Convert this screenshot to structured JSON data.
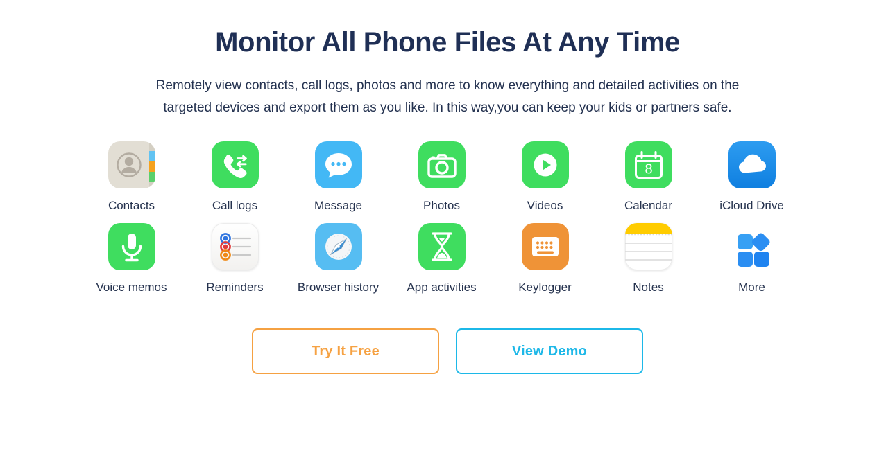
{
  "header": {
    "title": "Monitor All Phone Files At Any Time",
    "subtitle": "Remotely view contacts, call logs, photos and more to know everything and detailed activities on the targeted devices and export them as you like. In this way,you can keep your kids or partners safe."
  },
  "features": {
    "row1": [
      {
        "label": "Contacts",
        "icon": "contacts-icon",
        "color": "#e2ded4"
      },
      {
        "label": "Call logs",
        "icon": "call-logs-icon",
        "color": "#3fdd5f"
      },
      {
        "label": "Message",
        "icon": "message-icon",
        "color": "#43b8f5"
      },
      {
        "label": "Photos",
        "icon": "photos-icon",
        "color": "#3fdd5f"
      },
      {
        "label": "Videos",
        "icon": "videos-icon",
        "color": "#3fdd5f"
      },
      {
        "label": "Calendar",
        "icon": "calendar-icon",
        "color": "#3fdd5f"
      },
      {
        "label": "iCloud Drive",
        "icon": "icloud-drive-icon",
        "color": "#1e8ee8"
      }
    ],
    "row2": [
      {
        "label": "Voice memos",
        "icon": "voice-memos-icon",
        "color": "#3fdd5f"
      },
      {
        "label": "Reminders",
        "icon": "reminders-icon",
        "color": "#f5f4f2"
      },
      {
        "label": "Browser history",
        "icon": "browser-history-icon",
        "color": "#56bdf2"
      },
      {
        "label": "App activities",
        "icon": "app-activities-icon",
        "color": "#3fdd5f"
      },
      {
        "label": "Keylogger",
        "icon": "keylogger-icon",
        "color": "#ef9337"
      },
      {
        "label": "Notes",
        "icon": "notes-icon",
        "color": "#ffcc00"
      },
      {
        "label": "More",
        "icon": "more-icon",
        "color": "#2b95f0"
      }
    ]
  },
  "calendar": {
    "day": "8"
  },
  "cta": {
    "try_label": "Try It Free",
    "try_color": "#f6a243",
    "demo_label": "View Demo",
    "demo_color": "#1eb8e8"
  }
}
